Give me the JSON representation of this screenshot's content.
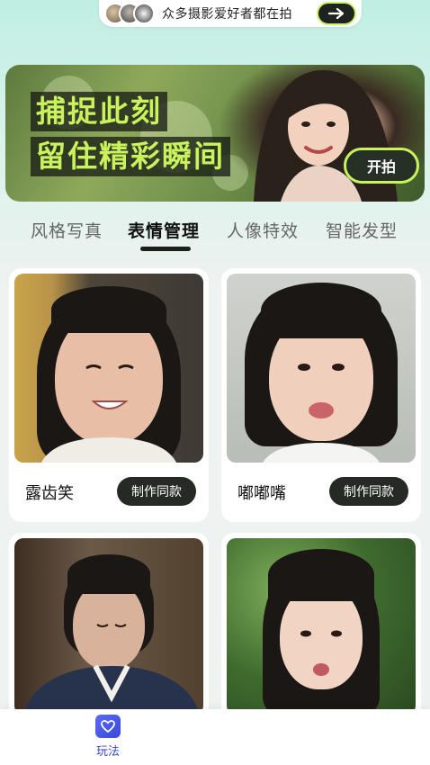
{
  "top_pill": {
    "text": "众多摄影爱好者都在拍",
    "arrow_icon": "arrow-right-icon"
  },
  "banner": {
    "line1": "捕捉此刻",
    "line2": "留住精彩瞬间",
    "start_label": "开拍",
    "accent_color": "#c9f25c"
  },
  "tabs": [
    {
      "label": "风格写真",
      "active": false
    },
    {
      "label": "表情管理",
      "active": true
    },
    {
      "label": "人像特效",
      "active": false
    },
    {
      "label": "智能发型",
      "active": false
    }
  ],
  "cards": [
    {
      "title": "露齿笑",
      "button": "制作同款"
    },
    {
      "title": "嘟嘟嘴",
      "button": "制作同款"
    },
    {
      "title": "",
      "button": ""
    },
    {
      "title": "",
      "button": ""
    }
  ],
  "bottom_nav": {
    "items": [
      {
        "label": "玩法",
        "icon": "heart-icon",
        "active": true
      }
    ]
  }
}
